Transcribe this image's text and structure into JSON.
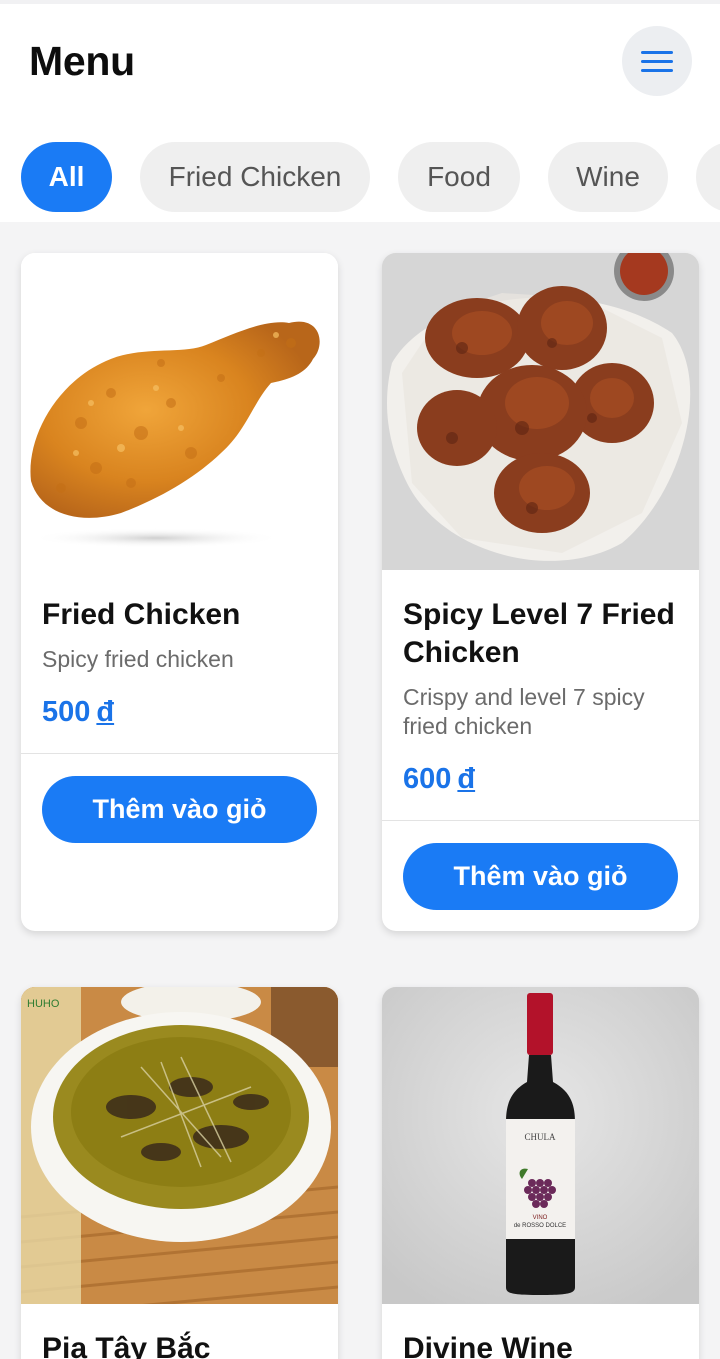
{
  "header": {
    "title": "Menu",
    "menu_icon": "hamburger-menu-icon"
  },
  "tabs": [
    {
      "label": "All",
      "active": true
    },
    {
      "label": "Fried Chicken",
      "active": false
    },
    {
      "label": "Food",
      "active": false
    },
    {
      "label": "Wine",
      "active": false
    }
  ],
  "products": [
    {
      "name": "Fried Chicken",
      "description": "Spicy fried chicken",
      "price": "500",
      "currency": "đ",
      "button": "Thêm vào giỏ"
    },
    {
      "name": "Spicy Level 7 Fried Chicken",
      "description": "Crispy and level 7 spicy fried chicken",
      "price": "600",
      "currency": "đ",
      "button": "Thêm vào giỏ"
    },
    {
      "name": "Pia Tây Bắc",
      "watermark": "HUHO"
    },
    {
      "name": "Divine Wine",
      "bottle_label": {
        "brand": "CHULA",
        "line1": "VINO",
        "line2": "de ROSSO DOLCE"
      }
    }
  ],
  "colors": {
    "accent": "#1a7bf5",
    "price": "#1a73e8",
    "background": "#f4f4f5"
  }
}
